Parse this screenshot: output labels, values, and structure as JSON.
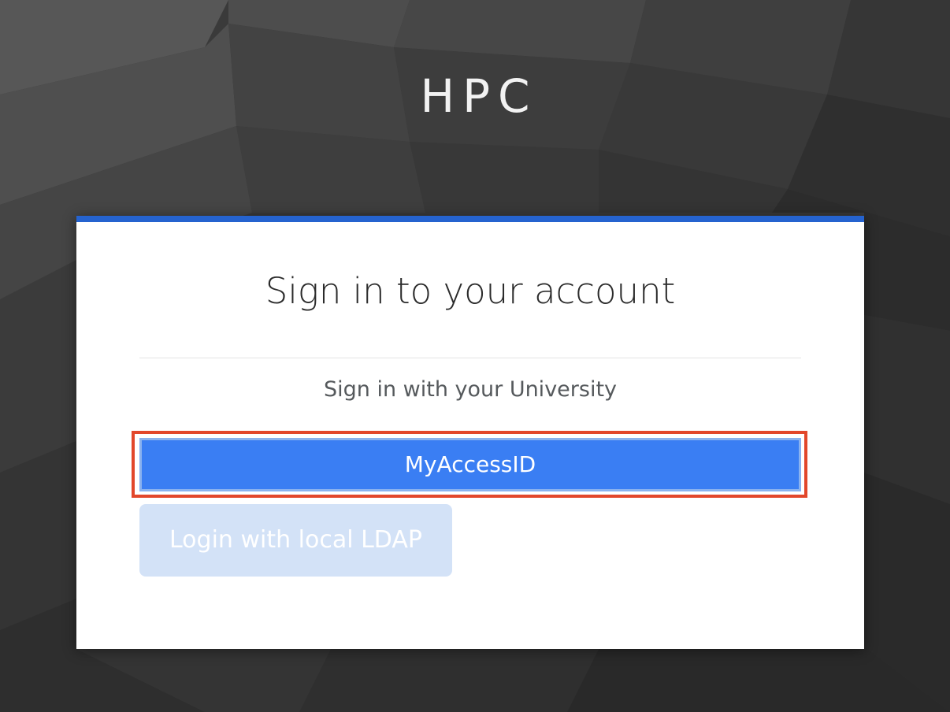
{
  "realm": {
    "title": "HPC"
  },
  "card": {
    "heading": "Sign in to your account",
    "idp_section_label": "Sign in with your University",
    "idp_button_label": "MyAccessID",
    "ldap_button_label": "Login with local LDAP"
  },
  "colors": {
    "accent_border": "#2563cf",
    "idp_button": "#3a7ef3",
    "highlight_box": "#e2472b",
    "ldap_button_disabled": "#d3e2f7"
  }
}
